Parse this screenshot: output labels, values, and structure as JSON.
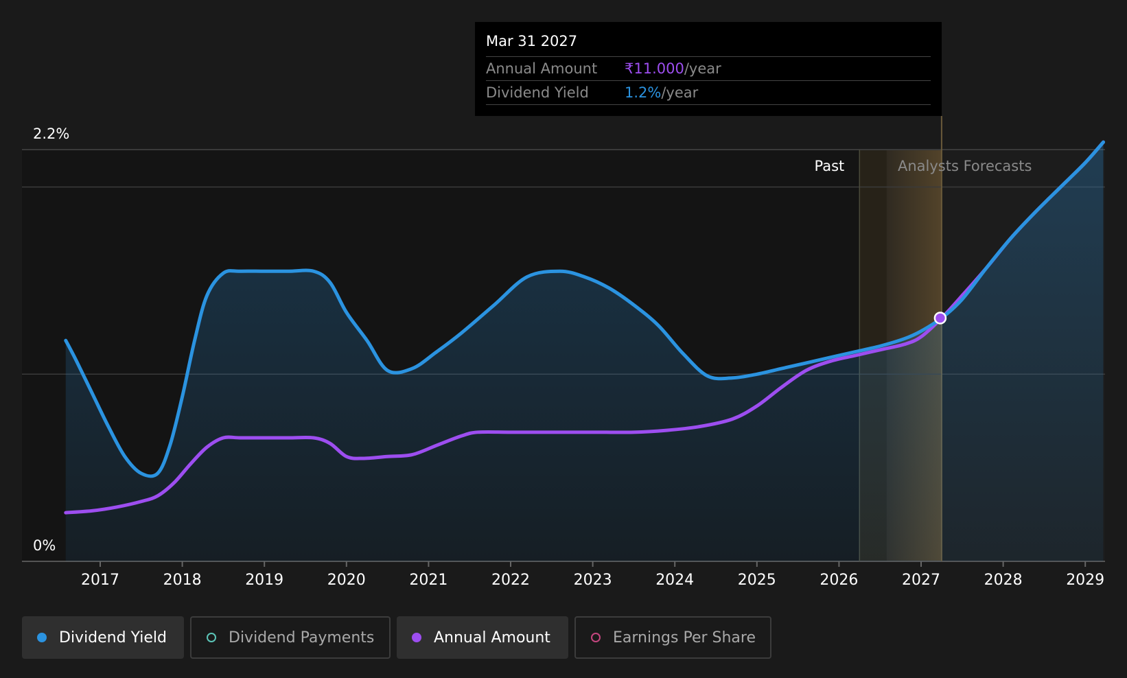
{
  "colors": {
    "background": "#1a1a1a",
    "plot_past": "#141414",
    "dividend_yield": "#2b93e0",
    "annual_amount": "#9d4ef0",
    "dividend_payments": "#5cc5b8",
    "earnings_per_share": "#c5467f",
    "forecast_band": "#4a3a22"
  },
  "tooltip": {
    "date": "Mar 31 2027",
    "rows": [
      {
        "label": "Annual Amount",
        "value": "₹11.000",
        "unit": "/year",
        "color": "#9d4ef0"
      },
      {
        "label": "Dividend Yield",
        "value": "1.2%",
        "unit": "/year",
        "color": "#2b93e0"
      }
    ]
  },
  "period_labels": {
    "past": "Past",
    "forecast": "Analysts Forecasts"
  },
  "legend": [
    {
      "label": "Dividend Yield",
      "active": true,
      "marker": "filled",
      "color": "#2b93e0"
    },
    {
      "label": "Dividend Payments",
      "active": false,
      "marker": "hollow",
      "color": "#5cc5b8"
    },
    {
      "label": "Annual Amount",
      "active": true,
      "marker": "filled",
      "color": "#9d4ef0"
    },
    {
      "label": "Earnings Per Share",
      "active": false,
      "marker": "hollow",
      "color": "#c5467f"
    }
  ],
  "chart_data": {
    "type": "line",
    "y_tick_labels": [
      "2.2%",
      "0%"
    ],
    "ylim": [
      0,
      2.2
    ],
    "xlim": [
      2016.58,
      2029.22
    ],
    "x_ticks": [
      2017,
      2018,
      2019,
      2020,
      2021,
      2022,
      2023,
      2024,
      2025,
      2026,
      2027,
      2028,
      2029
    ],
    "past_end": 2026.25,
    "forecast_start": 2026.58,
    "highlight_date": 2027.25,
    "grid": true,
    "series": [
      {
        "name": "Dividend Yield",
        "x": [
          2016.58,
          2016.7,
          2016.9,
          2017.1,
          2017.3,
          2017.5,
          2017.7,
          2017.85,
          2018.0,
          2018.15,
          2018.3,
          2018.5,
          2018.7,
          2019.0,
          2019.3,
          2019.6,
          2019.8,
          2020.0,
          2020.25,
          2020.5,
          2020.8,
          2021.1,
          2021.4,
          2021.8,
          2022.2,
          2022.6,
          2022.9,
          2023.2,
          2023.5,
          2023.8,
          2024.1,
          2024.4,
          2024.7,
          2025.0,
          2025.3,
          2025.6,
          2025.9,
          2026.2,
          2026.5,
          2026.8,
          2027.0,
          2027.25,
          2027.5,
          2027.8,
          2028.1,
          2028.4,
          2028.7,
          2029.0,
          2029.22
        ],
        "y": [
          1.18,
          1.08,
          0.9,
          0.72,
          0.56,
          0.47,
          0.47,
          0.62,
          0.88,
          1.18,
          1.42,
          1.54,
          1.55,
          1.55,
          1.55,
          1.55,
          1.49,
          1.33,
          1.18,
          1.02,
          1.03,
          1.12,
          1.22,
          1.37,
          1.52,
          1.55,
          1.52,
          1.46,
          1.37,
          1.26,
          1.11,
          0.99,
          0.98,
          1.0,
          1.03,
          1.06,
          1.09,
          1.12,
          1.15,
          1.19,
          1.23,
          1.3,
          1.4,
          1.57,
          1.73,
          1.87,
          2.0,
          2.13,
          2.24
        ]
      },
      {
        "name": "Annual Amount",
        "x": [
          2016.58,
          2016.9,
          2017.2,
          2017.5,
          2017.7,
          2017.9,
          2018.1,
          2018.3,
          2018.5,
          2018.7,
          2019.0,
          2019.3,
          2019.6,
          2019.8,
          2020.0,
          2020.2,
          2020.5,
          2020.8,
          2021.1,
          2021.4,
          2021.6,
          2022.0,
          2022.5,
          2023.0,
          2023.5,
          2023.9,
          2024.3,
          2024.7,
          2025.0,
          2025.3,
          2025.6,
          2025.9,
          2026.2,
          2026.5,
          2026.8,
          2027.0,
          2027.25,
          2027.5,
          2027.8,
          2028.1,
          2028.4,
          2028.7,
          2029.0,
          2029.22
        ],
        "y": [
          0.26,
          0.27,
          0.29,
          0.32,
          0.35,
          0.42,
          0.52,
          0.61,
          0.66,
          0.66,
          0.66,
          0.66,
          0.66,
          0.63,
          0.56,
          0.55,
          0.56,
          0.57,
          0.62,
          0.67,
          0.69,
          0.69,
          0.69,
          0.69,
          0.69,
          0.7,
          0.72,
          0.76,
          0.83,
          0.93,
          1.02,
          1.07,
          1.1,
          1.13,
          1.16,
          1.2,
          1.3,
          1.42,
          1.57,
          1.73,
          1.87,
          2.0,
          2.13,
          2.24
        ]
      }
    ]
  }
}
